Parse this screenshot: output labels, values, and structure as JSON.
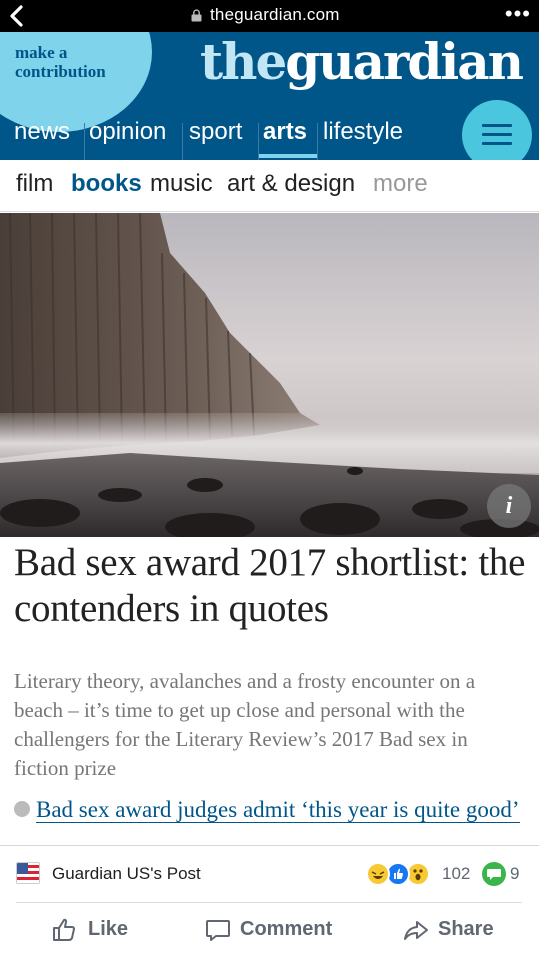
{
  "browser": {
    "url": "theguardian.com",
    "back_icon": "chevron-left-icon",
    "menu_icon": "more-dots-icon",
    "more_glyph": "•••"
  },
  "header": {
    "contribute_label": "make a contribution",
    "logo_the": "the",
    "logo_guardian": "guardian",
    "nav": [
      "news",
      "opinion",
      "sport",
      "arts",
      "lifestyle"
    ],
    "active_nav": "arts",
    "menu_icon": "hamburger-icon",
    "colors": {
      "brand": "#005689",
      "accent": "#7fd3ea"
    }
  },
  "subnav": {
    "items": [
      "film",
      "books",
      "music",
      "art & design",
      "more"
    ],
    "active": "books"
  },
  "hero": {
    "info_label": "i"
  },
  "article": {
    "headline": "Bad sex award 2017 shortlist: the contenders in quotes",
    "standfirst": "Literary theory, avalanches and a frosty encounter on a beach – it’s time to get up close and personal with the challengers for the Literary Review’s 2017 Bad sex in fiction prize",
    "related_link": "Bad sex award judges admit ‘this year is quite good’"
  },
  "facebook": {
    "post_name": "Guardian US's Post",
    "reaction_count": "102",
    "comment_count": "9",
    "actions": {
      "like": "Like",
      "comment": "Comment",
      "share": "Share"
    }
  }
}
